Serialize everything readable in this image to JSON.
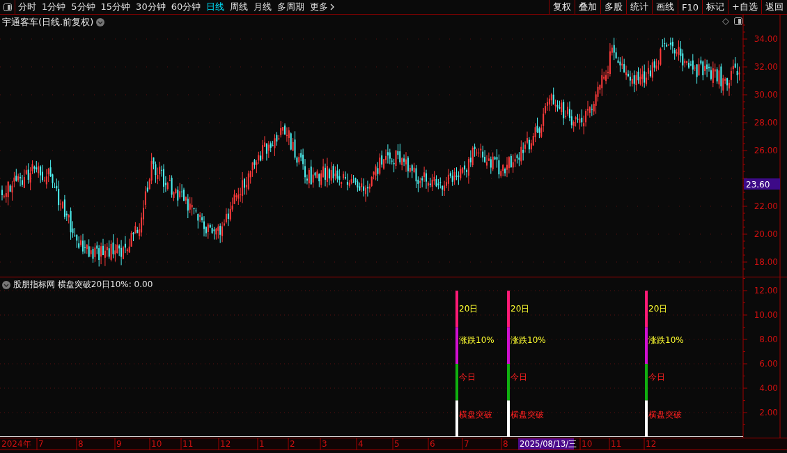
{
  "toolbar": {
    "periods": [
      {
        "label": "分时",
        "selected": false
      },
      {
        "label": "1分钟",
        "selected": false
      },
      {
        "label": "5分钟",
        "selected": false
      },
      {
        "label": "15分钟",
        "selected": false
      },
      {
        "label": "30分钟",
        "selected": false
      },
      {
        "label": "60分钟",
        "selected": false
      },
      {
        "label": "日线",
        "selected": true
      },
      {
        "label": "周线",
        "selected": false
      },
      {
        "label": "月线",
        "selected": false
      },
      {
        "label": "多周期",
        "selected": false
      }
    ],
    "more": "更多",
    "tools": [
      "复权",
      "叠加",
      "多股",
      "统计",
      "画线",
      "F10",
      "标记",
      "+自选",
      "返回"
    ]
  },
  "price_pane": {
    "title": "宇通客车(日线.前复权)",
    "ticks": [
      "34.00",
      "32.00",
      "30.00",
      "28.00",
      "26.00",
      "22.00",
      "20.00",
      "18.00"
    ],
    "current_price": "23.60"
  },
  "indicator_pane": {
    "title": "股朋指标网 横盘突破20日10%: 0.00",
    "ticks": [
      "12.00",
      "10.00",
      "8.00",
      "6.00",
      "4.00",
      "2.00"
    ],
    "signals": [
      {
        "labels": [
          "20日",
          "涨跌10%",
          "今日",
          "横盘突破"
        ]
      },
      {
        "labels": [
          "20日",
          "涨跌10%",
          "今日",
          "横盘突破"
        ]
      },
      {
        "labels": [
          "20日",
          "涨跌10%",
          "今日",
          "横盘突破"
        ]
      }
    ]
  },
  "date_axis": [
    {
      "text": "2024年",
      "kind": "year"
    },
    {
      "text": "7",
      "kind": "month"
    },
    {
      "text": "8",
      "kind": "month"
    },
    {
      "text": "9",
      "kind": "month"
    },
    {
      "text": "10",
      "kind": "month"
    },
    {
      "text": "11",
      "kind": "month"
    },
    {
      "text": "12",
      "kind": "month"
    },
    {
      "text": "1",
      "kind": "month"
    },
    {
      "text": "2",
      "kind": "month"
    },
    {
      "text": "3",
      "kind": "month"
    },
    {
      "text": "4",
      "kind": "month"
    },
    {
      "text": "5",
      "kind": "month"
    },
    {
      "text": "6",
      "kind": "month"
    },
    {
      "text": "7",
      "kind": "month"
    },
    {
      "text": "8",
      "kind": "month"
    },
    {
      "text": "2025/08/13/三",
      "kind": "cursor"
    },
    {
      "text": "10",
      "kind": "month"
    },
    {
      "text": "11",
      "kind": "month"
    },
    {
      "text": "12",
      "kind": "month"
    }
  ]
}
